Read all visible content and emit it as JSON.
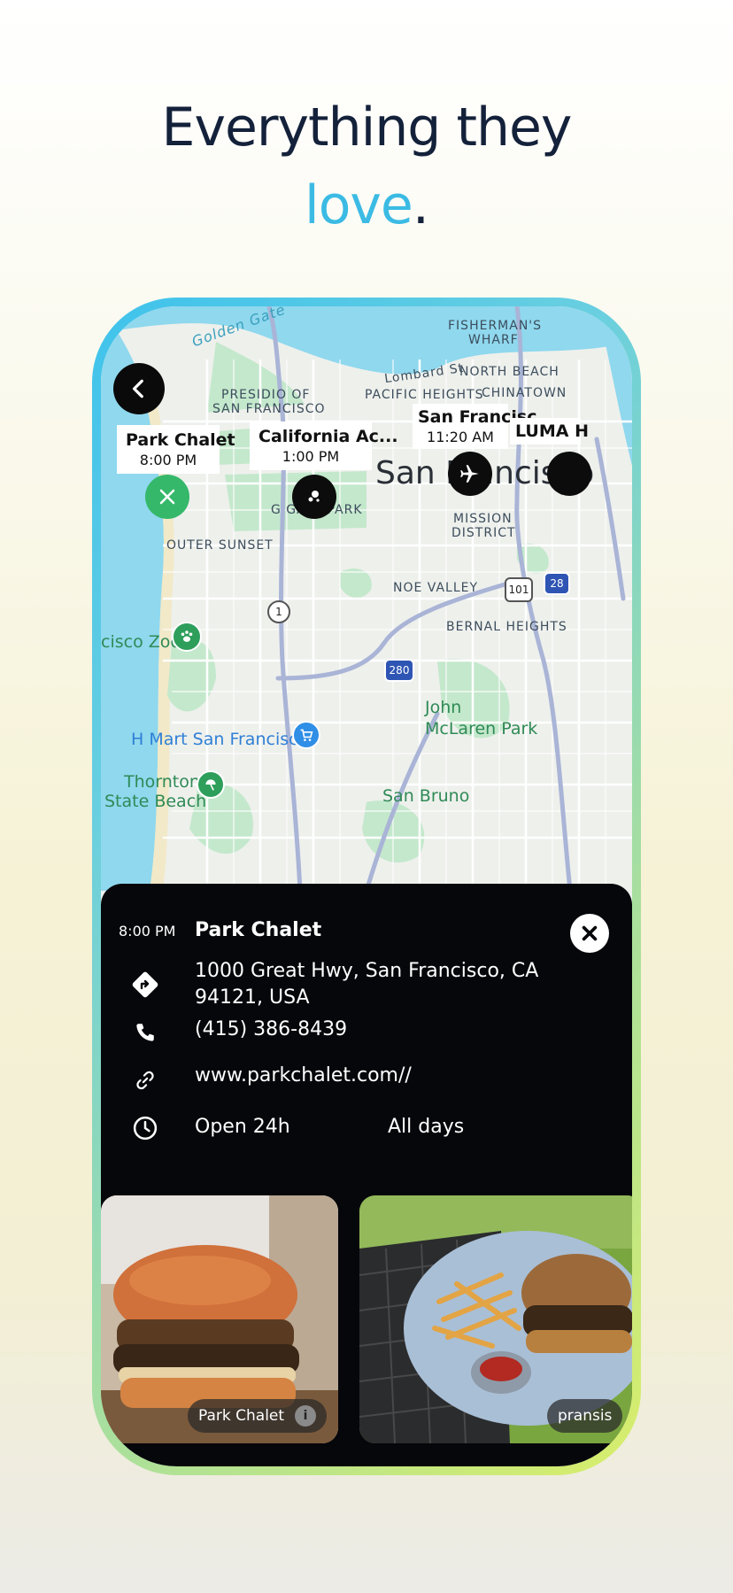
{
  "headline": {
    "line1": "Everything they",
    "accent": "love",
    "punct": "."
  },
  "map": {
    "labels": {
      "water": "Golden Gate",
      "fishermans": "FISHERMAN'S",
      "wharf": "WHARF",
      "lombard": "Lombard St",
      "north_beach": "NORTH BEACH",
      "presidio1": "PRESIDIO OF",
      "presidio2": "SAN FRANCISCO",
      "pacific": "PACIFIC HEIGHTS",
      "chinatown": "CHINATOWN",
      "city": "San Francisco",
      "ggpark": "G    GATE PARK",
      "mission1": "MISSION",
      "mission2": "DISTRICT",
      "outer_sunset": "OUTER SUNSET",
      "noe": "NOE VALLEY",
      "bernal": "BERNAL HEIGHTS",
      "zoo": "cisco Zoo",
      "john1": "John",
      "john2": "McLaren Park",
      "hmart": "H Mart San Francisco",
      "thornton1": "Thornton",
      "thornton2": "State Beach",
      "sanbruno": "San Bruno",
      "hwy1": "1",
      "hwy101": "101",
      "hwy280": "280",
      "hwy28": "28"
    },
    "markers": [
      {
        "title": "Park Chalet",
        "time": "8:00 PM"
      },
      {
        "title": "California Ac...",
        "time": "1:00 PM"
      },
      {
        "title": "San Francisc",
        "time": "11:20 AM"
      },
      {
        "title": "LUMA H",
        "time": ""
      }
    ],
    "colors": {
      "water": "#8fd8ee",
      "park": "#c4e8cc",
      "road": "#ffffff",
      "highway": "#a9b4d6",
      "land": "#eef0ec"
    }
  },
  "sheet": {
    "time": "8:00 PM",
    "place_name": "Park Chalet",
    "address": "1000 Great Hwy, San Francisco, CA 94121, USA",
    "phone": "(415) 386-8439",
    "website": "www.parkchalet.com//",
    "hours": "Open 24h",
    "days": "All days",
    "photos": [
      {
        "caption": "Park Chalet"
      },
      {
        "caption": "pransis"
      }
    ],
    "icons": [
      "directions-icon",
      "phone-icon",
      "link-icon",
      "clock-icon",
      "close-icon",
      "info-icon"
    ]
  },
  "colors": {
    "accent": "#3bbbe4",
    "headline": "#14213a",
    "sheet_bg": "#06070b"
  }
}
